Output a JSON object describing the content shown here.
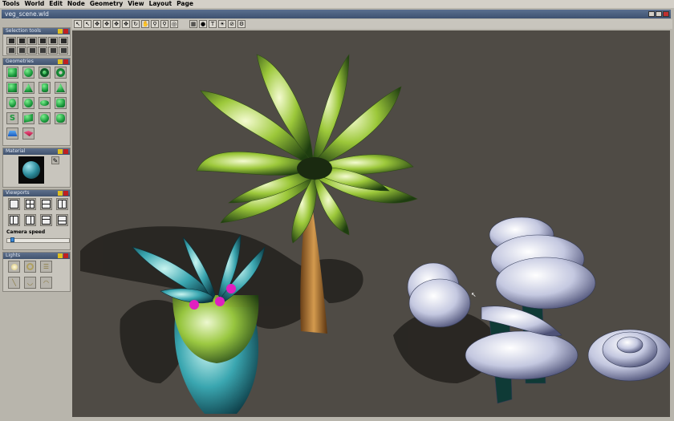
{
  "menu": {
    "items": [
      "Tools",
      "World",
      "Edit",
      "Node",
      "Geometry",
      "View",
      "Layout",
      "Page"
    ]
  },
  "window": {
    "title": "veg_scene.wld"
  },
  "panels": {
    "selection": {
      "title": "Selection tools"
    },
    "geometries": {
      "title": "Geometries"
    },
    "material": {
      "title": "Material"
    },
    "viewports": {
      "title": "Viewports",
      "camera_speed_label": "Camera speed",
      "camera_speed_value": 0.05
    },
    "lights": {
      "title": "Lights"
    }
  },
  "colors": {
    "accent": "#4a5e7f",
    "viewport_bg": "#4f4b45",
    "geometry_green": "#1fb34a",
    "flower_magenta": "#e020c0"
  }
}
